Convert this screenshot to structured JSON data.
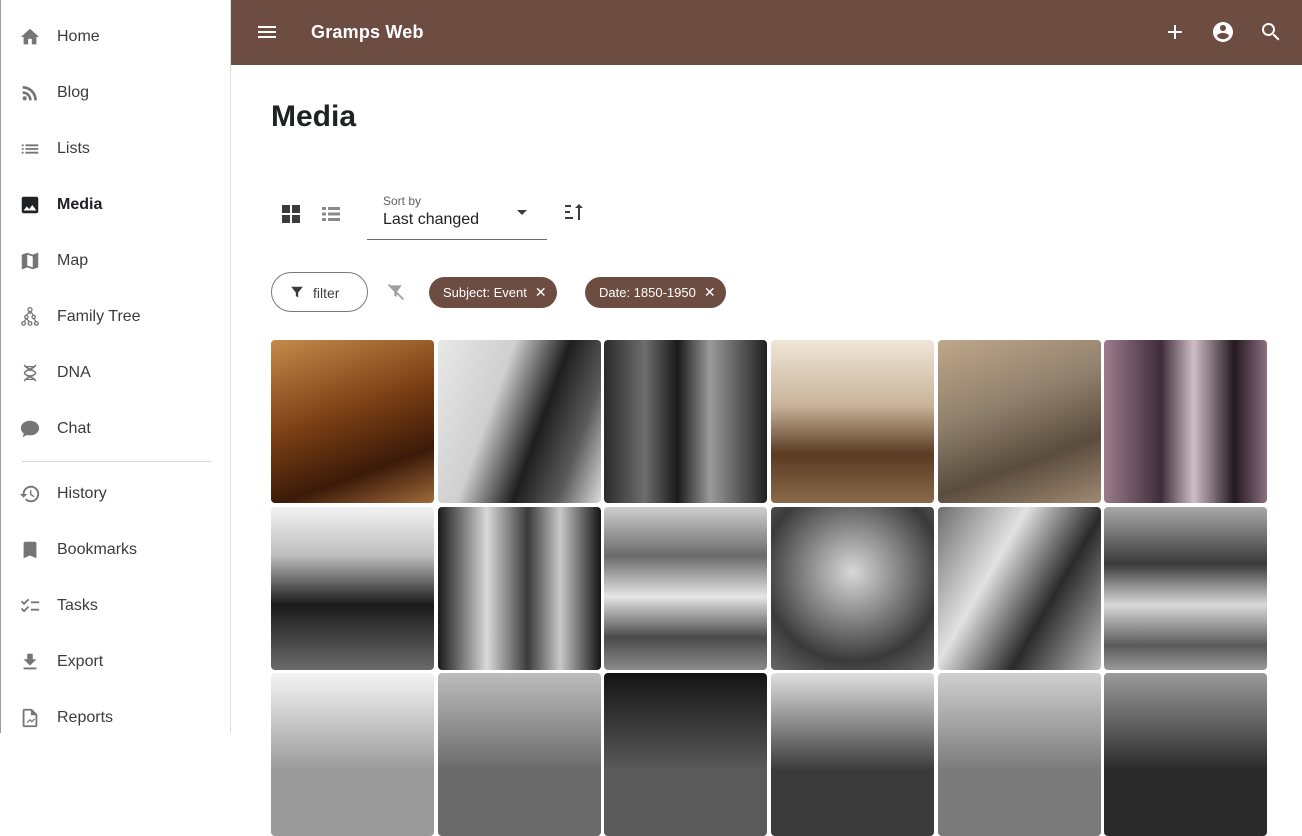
{
  "app": {
    "title": "Gramps Web"
  },
  "sidebar": {
    "items": [
      {
        "label": "Home",
        "icon": "home-icon"
      },
      {
        "label": "Blog",
        "icon": "rss-icon"
      },
      {
        "label": "Lists",
        "icon": "list-icon"
      },
      {
        "label": "Media",
        "icon": "image-icon"
      },
      {
        "label": "Map",
        "icon": "map-icon"
      },
      {
        "label": "Family Tree",
        "icon": "family-tree-icon"
      },
      {
        "label": "DNA",
        "icon": "dna-icon"
      },
      {
        "label": "Chat",
        "icon": "chat-icon"
      },
      {
        "label": "History",
        "icon": "history-icon"
      },
      {
        "label": "Bookmarks",
        "icon": "bookmark-icon"
      },
      {
        "label": "Tasks",
        "icon": "tasks-icon"
      },
      {
        "label": "Export",
        "icon": "download-icon"
      },
      {
        "label": "Reports",
        "icon": "report-icon"
      }
    ],
    "active": "Media"
  },
  "topbar": {
    "icons": [
      "menu-icon",
      "add-icon",
      "account-icon",
      "search-icon"
    ]
  },
  "main": {
    "title": "Media",
    "sort": {
      "caption": "Sort by",
      "value": "Last changed"
    },
    "filter_label": "filter",
    "chips": [
      {
        "label": "Subject: Event"
      },
      {
        "label": "Date: 1850-1950"
      }
    ],
    "chip_remove": "✕"
  },
  "colors": {
    "brand": "#6d4c41"
  }
}
